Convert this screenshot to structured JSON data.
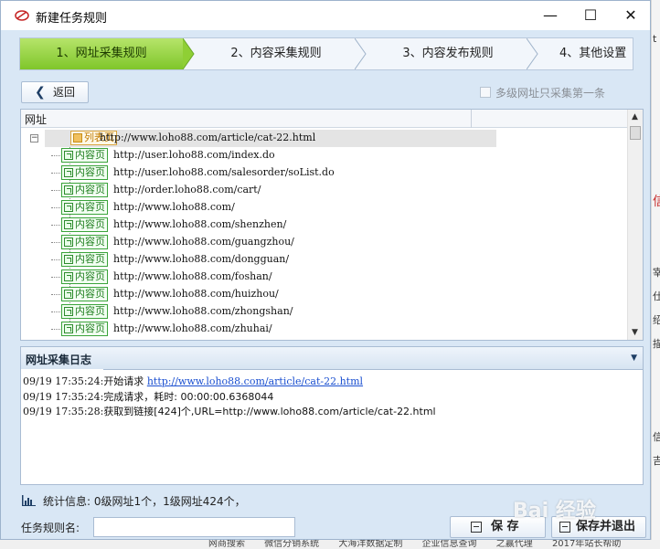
{
  "window": {
    "title": "新建任务规则",
    "minimize_glyph": "—",
    "maximize_glyph": "☐",
    "close_glyph": "✕"
  },
  "steps": [
    {
      "label": "1、网址采集规则",
      "active": true
    },
    {
      "label": "2、内容采集规则",
      "active": false
    },
    {
      "label": "3、内容发布规则",
      "active": false
    },
    {
      "label": "4、其他设置",
      "active": false
    }
  ],
  "toolbar": {
    "back_label": "返回",
    "multilevel_checkbox_label": "多级网址只采集第一条",
    "multilevel_checked": false
  },
  "tree": {
    "column_header": "网址",
    "root": {
      "tag": "列表页",
      "url": "http://www.loho88.com/article/cat-22.html",
      "expander": "−"
    },
    "children": [
      {
        "tag": "内容页",
        "url": "http://user.loho88.com/index.do"
      },
      {
        "tag": "内容页",
        "url": "http://user.loho88.com/salesorder/soList.do"
      },
      {
        "tag": "内容页",
        "url": "http://order.loho88.com/cart/"
      },
      {
        "tag": "内容页",
        "url": "http://www.loho88.com/"
      },
      {
        "tag": "内容页",
        "url": "http://www.loho88.com/shenzhen/"
      },
      {
        "tag": "内容页",
        "url": "http://www.loho88.com/guangzhou/"
      },
      {
        "tag": "内容页",
        "url": "http://www.loho88.com/dongguan/"
      },
      {
        "tag": "内容页",
        "url": "http://www.loho88.com/foshan/"
      },
      {
        "tag": "内容页",
        "url": "http://www.loho88.com/huizhou/"
      },
      {
        "tag": "内容页",
        "url": "http://www.loho88.com/zhongshan/"
      },
      {
        "tag": "内容页",
        "url": "http://www.loho88.com/zhuhai/"
      }
    ]
  },
  "log": {
    "title": "网址采集日志",
    "lines": [
      {
        "time": "09/19 17:35:24:",
        "text": "开始请求 ",
        "link": "http://www.loho88.com/article/cat-22.html"
      },
      {
        "time": "09/19 17:35:24:",
        "text": "完成请求，耗时: 00:00:00.6368044",
        "link": ""
      },
      {
        "time": "09/19 17:35:28:",
        "text": "获取到链接[424]个,URL=http://www.loho88.com/article/cat-22.html",
        "link": ""
      }
    ]
  },
  "stats": {
    "text": "统计信息: 0级网址1个，1级网址424个，"
  },
  "footer": {
    "name_label": "任务规则名:",
    "name_value": "",
    "save_label": "保 存",
    "save_exit_label": "保存并退出"
  },
  "watermark": "Bai 经验",
  "background": {
    "right_glyphs": [
      "t",
      "信",
      "宰",
      "仕",
      "绍",
      "描",
      "信",
      "吉"
    ],
    "bottom_text": [
      "网商搜索",
      "微信分销系统",
      "大海洋数据定制",
      "企业信息查询",
      "之赢代理",
      "2017年站长帮助"
    ]
  },
  "colors": {
    "accent_green": "#7fc62a",
    "link_blue": "#1a4fd0",
    "list_tag": "#c07a00",
    "content_tag": "#1e7d1e"
  }
}
